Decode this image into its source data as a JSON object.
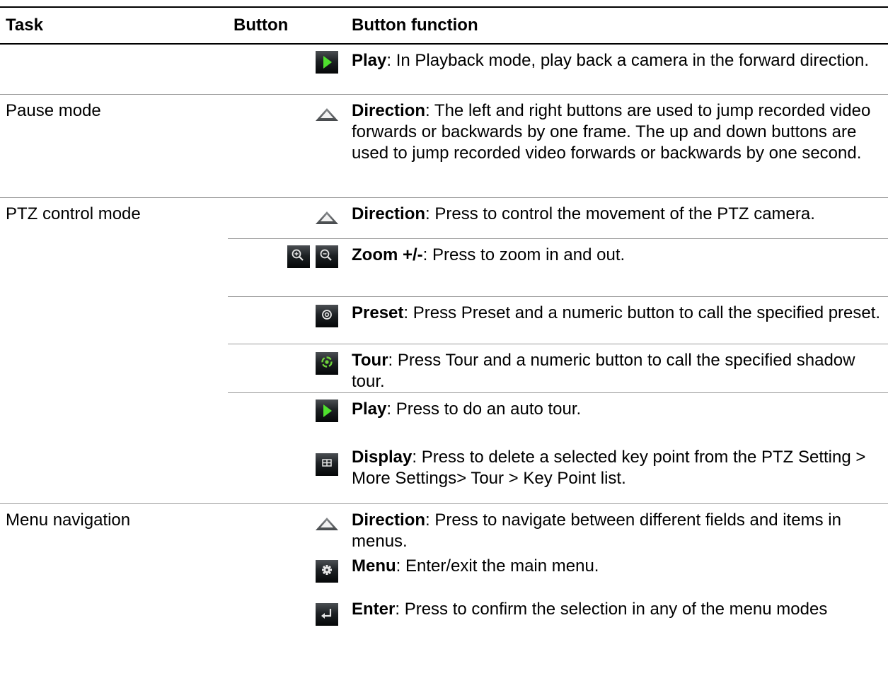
{
  "headers": {
    "task": "Task",
    "button": "Button",
    "function": "Button function"
  },
  "rows": [
    {
      "task": "",
      "icons": [
        "play-icon"
      ],
      "name": "Play",
      "desc": ": In Playback mode, play back a camera in the forward direction."
    },
    {
      "task": "Pause mode",
      "icons": [
        "direction-up-icon"
      ],
      "name": "Direction",
      "desc": ": The left and right buttons are used to jump recorded video forwards or backwards by one frame. The up and down buttons are used to jump recorded video forwards or backwards by one second."
    },
    {
      "task": "PTZ control mode",
      "icons": [
        "direction-up-icon"
      ],
      "name": "Direction",
      "desc": ": Press to control the movement of the PTZ camera."
    },
    {
      "task": "",
      "icons": [
        "zoom-in-icon",
        "zoom-out-icon"
      ],
      "name": "Zoom +/-",
      "desc": ": Press to zoom in and out."
    },
    {
      "task": "",
      "icons": [
        "preset-icon"
      ],
      "name": "Preset",
      "desc": ": Press Preset and a numeric button to call the specified preset."
    },
    {
      "task": "",
      "icons": [
        "tour-icon"
      ],
      "name": "Tour",
      "desc": ": Press Tour and a numeric button to call the specified shadow tour."
    },
    {
      "task": "",
      "icons": [
        "play-icon"
      ],
      "name": "Play",
      "desc": ": Press to do an auto tour."
    },
    {
      "task": "",
      "icons": [
        "display-icon"
      ],
      "name": "Display",
      "desc": ": Press to delete a selected key point from the PTZ Setting > More Settings> Tour > Key Point list."
    },
    {
      "task": "Menu navigation",
      "icons": [
        "direction-up-icon"
      ],
      "name": "Direction",
      "desc": ": Press to navigate between different fields and items in menus."
    },
    {
      "task": "",
      "icons": [
        "menu-gear-icon"
      ],
      "name": "Menu",
      "desc": ": Enter/exit the main menu."
    },
    {
      "task": "",
      "icons": [
        "enter-icon"
      ],
      "name": "Enter",
      "desc": ": Press to confirm the selection in any of the menu modes"
    }
  ]
}
